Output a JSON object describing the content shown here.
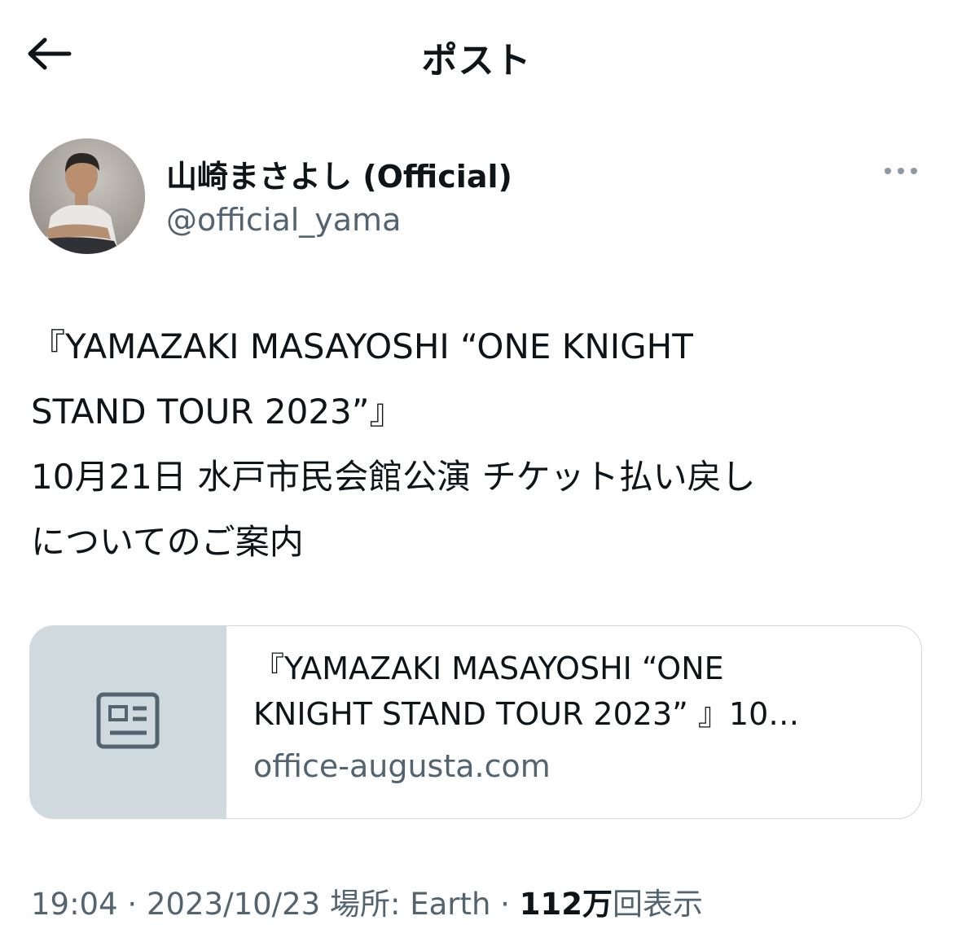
{
  "header": {
    "title": "ポスト",
    "back_icon": "arrow-left-icon"
  },
  "author": {
    "display_name": "山崎まさよし (Official)",
    "handle": "@official_yama",
    "more_icon": "more-horizontal-icon"
  },
  "post": {
    "lines": [
      "『YAMAZAKI MASAYOSHI “ONE KNIGHT",
      "STAND TOUR 2023”』",
      "10月21日 水戸市民会館公演 チケット払い戻し",
      "についてのご案内"
    ]
  },
  "link_card": {
    "icon": "news-article-icon",
    "title_lines": [
      "『YAMAZAKI MASAYOSHI “ONE",
      "KNIGHT STAND TOUR 2023” 』10…"
    ],
    "domain": "office-augusta.com"
  },
  "meta": {
    "time": "19:04",
    "separator": " · ",
    "date": "2023/10/23",
    "location_label": "場所: Earth",
    "views_count": "112万",
    "views_label": "回表示"
  },
  "colors": {
    "text_primary": "#0f1419",
    "text_secondary": "#536471",
    "border": "#cfd9de",
    "card_thumb_bg": "#cfd9de"
  }
}
